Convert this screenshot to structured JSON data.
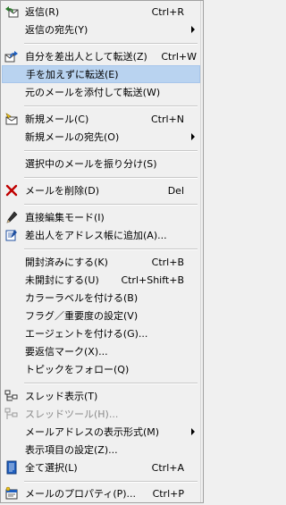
{
  "menu": {
    "items": [
      {
        "label": "返信(R)",
        "shortcut": "Ctrl+R",
        "icon": "reply-icon"
      },
      {
        "label": "返信の宛先(Y)",
        "shortcut": "",
        "submenu": true
      },
      {
        "label": "自分を差出人として転送(Z)",
        "shortcut": "Ctrl+W",
        "icon": "forward-as-sender-icon"
      },
      {
        "label": "手を加えずに転送(E)",
        "shortcut": "",
        "highlighted": true
      },
      {
        "label": "元のメールを添付して転送(W)",
        "shortcut": ""
      },
      {
        "label": "新規メール(C)",
        "shortcut": "Ctrl+N",
        "icon": "new-mail-icon"
      },
      {
        "label": "新規メールの宛先(O)",
        "shortcut": "",
        "submenu": true
      },
      {
        "label": "選択中のメールを振り分け(S)",
        "shortcut": ""
      },
      {
        "label": "メールを削除(D)",
        "shortcut": "Del",
        "icon": "delete-x-icon"
      },
      {
        "label": "直接編集モード(I)",
        "shortcut": "",
        "icon": "pencil-icon"
      },
      {
        "label": "差出人をアドレス帳に追加(A)...",
        "shortcut": "",
        "icon": "address-book-edit-icon"
      },
      {
        "label": "開封済みにする(K)",
        "shortcut": "Ctrl+B"
      },
      {
        "label": "未開封にする(U)",
        "shortcut": "Ctrl+Shift+B"
      },
      {
        "label": "カラーラベルを付ける(B)",
        "shortcut": ""
      },
      {
        "label": "フラグ／重要度の設定(V)",
        "shortcut": ""
      },
      {
        "label": "エージェントを付ける(G)...",
        "shortcut": ""
      },
      {
        "label": "要返信マーク(X)...",
        "shortcut": ""
      },
      {
        "label": "トピックをフォロー(Q)",
        "shortcut": ""
      },
      {
        "label": "スレッド表示(T)",
        "shortcut": "",
        "icon": "thread-view-icon"
      },
      {
        "label": "スレッドツール(H)...",
        "shortcut": "",
        "icon": "thread-tool-icon",
        "disabled": true
      },
      {
        "label": "メールアドレスの表示形式(M)",
        "shortcut": "",
        "submenu": true
      },
      {
        "label": "表示項目の設定(Z)...",
        "shortcut": ""
      },
      {
        "label": "全て選択(L)",
        "shortcut": "Ctrl+A",
        "icon": "select-all-icon"
      },
      {
        "label": "メールのプロパティ(P)...",
        "shortcut": "Ctrl+P",
        "icon": "properties-icon"
      }
    ]
  },
  "colors": {
    "highlight": "#b9d3f0",
    "disabled_text": "#8a8a8a",
    "delete_red": "#c00000"
  }
}
